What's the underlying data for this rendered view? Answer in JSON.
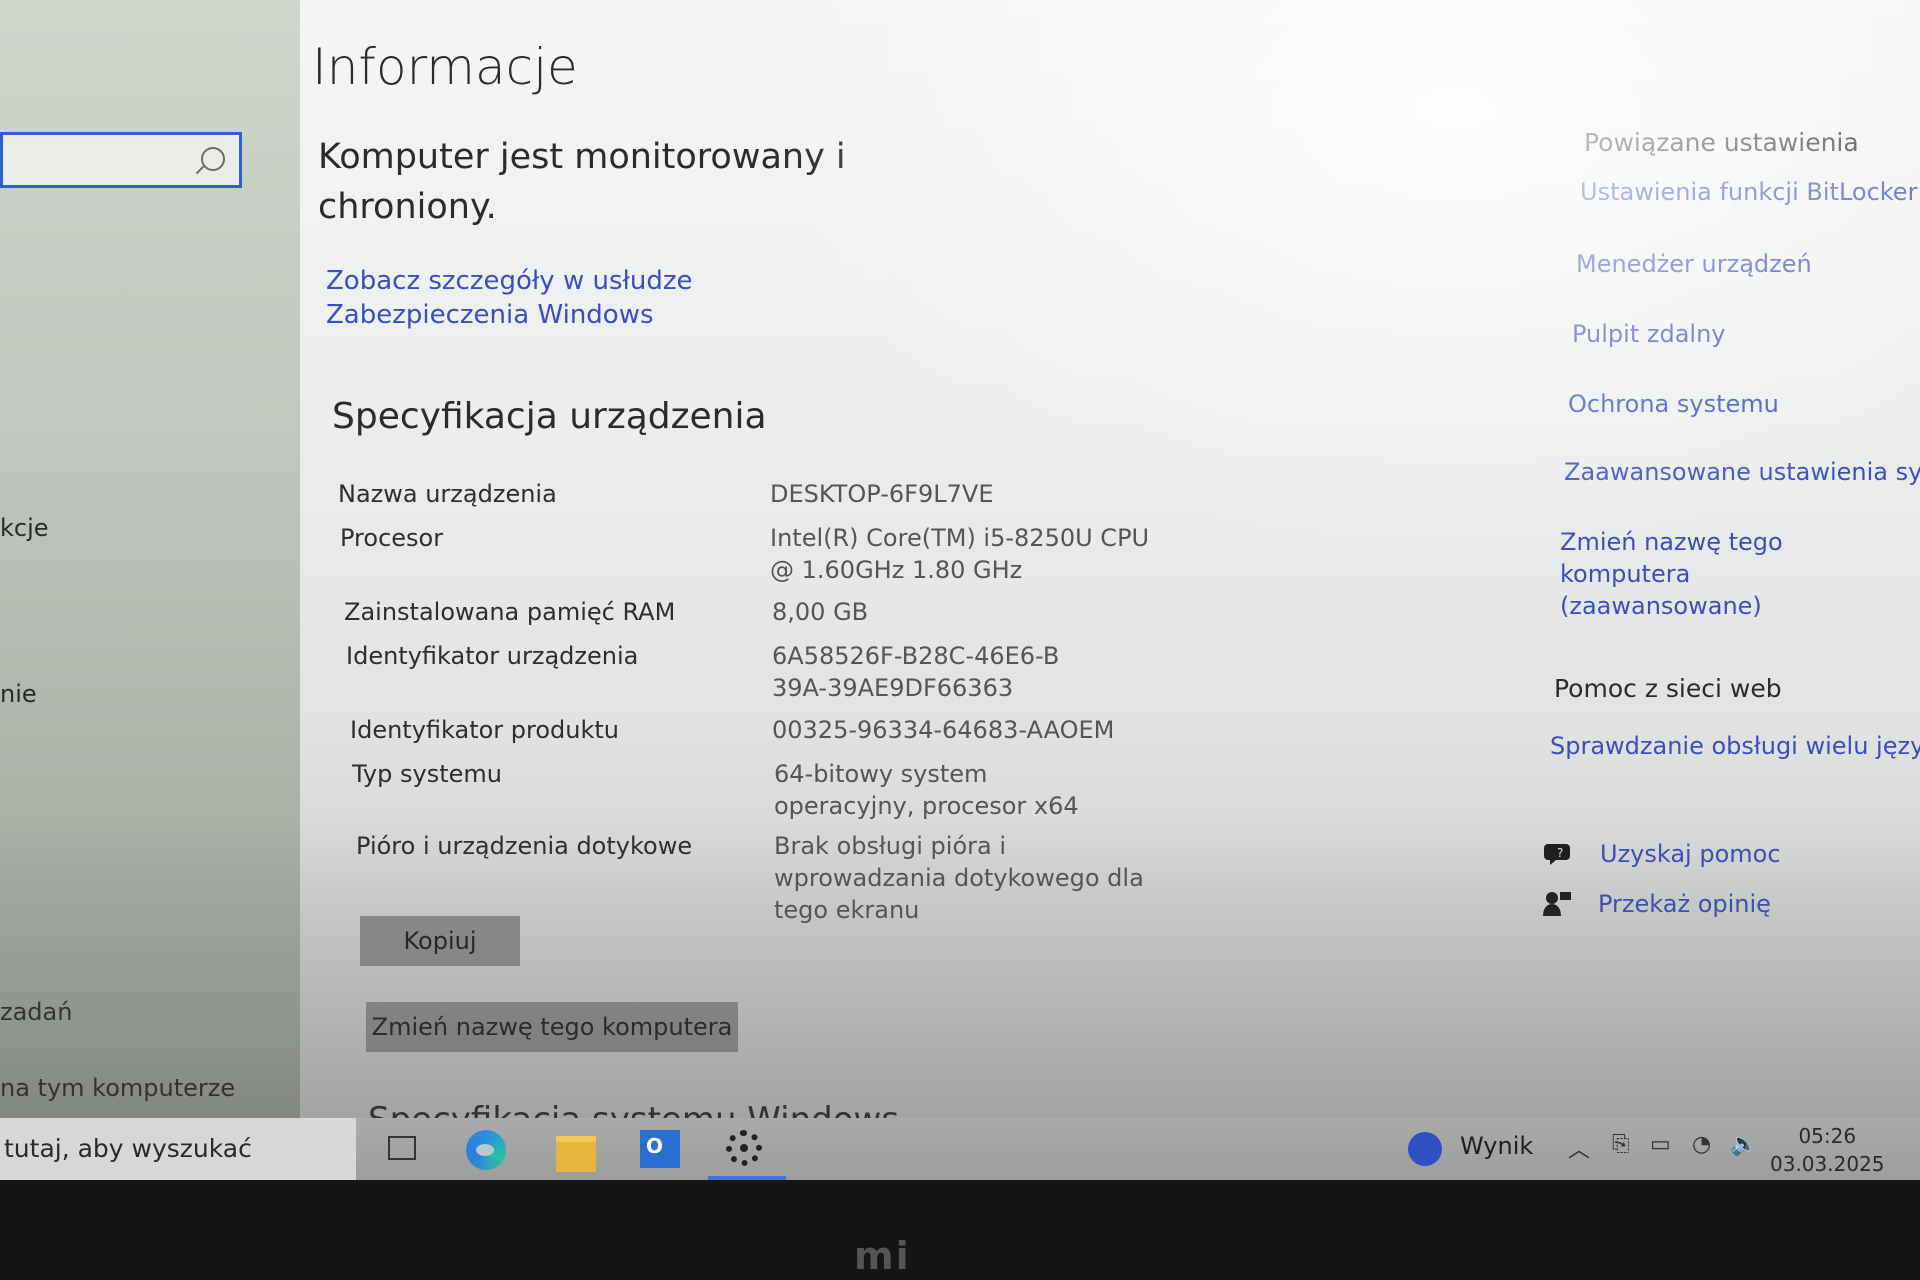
{
  "leftnav": {
    "items": [
      {
        "label": "kcje"
      },
      {
        "label": "nie"
      },
      {
        "label": "zadań"
      },
      {
        "label": "na tym komputerze"
      }
    ]
  },
  "main": {
    "title": "Informacje",
    "status": "Komputer jest monitorowany i chroniony.",
    "defender_link": "Zobacz szczegóły w usłudze Zabezpieczenia Windows",
    "device_spec_title": "Specyfikacja urządzenia",
    "specs": [
      {
        "label": "Nazwa urządzenia",
        "value": "DESKTOP-6F9L7VE"
      },
      {
        "label": "Procesor",
        "value": "Intel(R) Core(TM) i5-8250U CPU @ 1.60GHz   1.80 GHz"
      },
      {
        "label": "Zainstalowana pamięć RAM",
        "value": "8,00 GB"
      },
      {
        "label": "Identyfikator urządzenia",
        "value": "6A58526F-B28C-46E6-B39A-39AE9DF66363"
      },
      {
        "label": "Identyfikator produktu",
        "value": "00325-96334-64683-AAOEM"
      },
      {
        "label": "Typ systemu",
        "value": "64-bitowy system operacyjny, procesor x64"
      },
      {
        "label": "Pióro i urządzenia dotykowe",
        "value": "Brak obsługi pióra i wprowadzania dotykowego dla tego ekranu"
      }
    ],
    "copy_button": "Kopiuj",
    "rename_button": "Zmień nazwę tego komputera",
    "windows_spec_title": "Specyfikacja systemu Windows"
  },
  "related": {
    "title": "Powiązane ustawienia",
    "links": [
      "Ustawienia funkcji BitLocker",
      "Menedżer urządzeń",
      "Pulpit zdalny",
      "Ochrona systemu",
      "Zaawansowane ustawienia syste",
      "Zmień nazwę tego komputera (zaawansowane)"
    ]
  },
  "web_help": {
    "title": "Pomoc z sieci web",
    "link": "Sprawdzanie obsługi wielu językó"
  },
  "help": {
    "get_help": "Uzyskaj pomoc",
    "feedback": "Przekaż opinię"
  },
  "taskbar": {
    "search_placeholder": "tutaj, aby wyszukać",
    "wynik_label": "Wynik",
    "time": "05:26",
    "date": "03.03.2025"
  },
  "bezel": {
    "logo": "mi"
  },
  "colors": {
    "link": "#3b4fb8",
    "accent": "#2f5fc9"
  }
}
